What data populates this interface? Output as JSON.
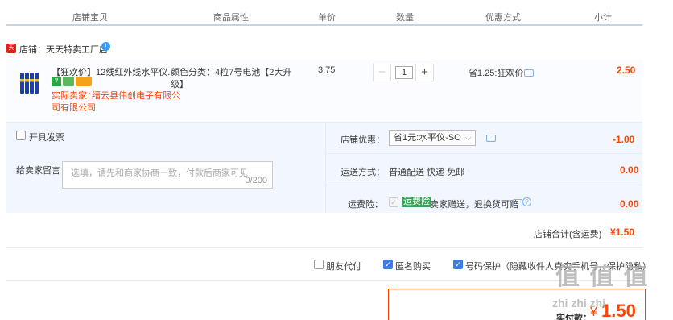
{
  "header": {
    "col_store_item": "店铺宝贝",
    "col_attributes": "商品属性",
    "col_price": "单价",
    "col_quantity": "数量",
    "col_discount": "优惠方式",
    "col_subtotal": "小计"
  },
  "store": {
    "badge": "天猫",
    "name": "店铺：天天特卖工厂店",
    "info_icon": "!"
  },
  "item": {
    "title": "【狂欢价】12线红外线水平仪...",
    "seller_label": "实际卖家：",
    "seller_name_line1": "缙云县伟创电子有限公",
    "seller_name_line2": "司有限公司",
    "badge_7": "7",
    "attributes_line1": "颜色分类：4粒7号电池【2大升",
    "attributes_line2": "级】",
    "unit_price": "3.75",
    "quantity": "1",
    "discount": "省1.25:狂欢价",
    "subtotal": "2.50"
  },
  "options": {
    "invoice_label": "开具发票",
    "message_label": "给卖家留言：",
    "message_placeholder": "选填，请先和商家协商一致，付款后商家可见",
    "message_count": "0/200",
    "store_discount_label": "店铺优惠：",
    "store_discount_value": "省1元:水平仪-SO",
    "store_discount_amount": "-1.00",
    "shipping_label": "运送方式：",
    "shipping_value": "普通配送 快递 免邮",
    "shipping_amount": "0.00",
    "insurance_label": "运费险：",
    "insurance_badge": "运费险",
    "insurance_desc": "卖家赠送，退换货可赔",
    "insurance_amount": "0.00"
  },
  "store_total": {
    "label": "店铺合计(含运费)",
    "value": "¥1.50"
  },
  "footer": {
    "friend_pay": "朋友代付",
    "anonymous": "匿名购买",
    "number_protect": "号码保护（隐藏收件人真实手机号，保护隐私）",
    "pay_label": "实付款：",
    "pay_currency": "¥",
    "pay_value": "1.50"
  },
  "watermark": {
    "line1": "值 值 值",
    "line2": "zhi zhi zhi"
  },
  "colors": {
    "price_red": "#ff4400",
    "accent_blue": "#3e7ce0",
    "header_line": "#c7d3e0",
    "option_bg": "#f2f7ff"
  }
}
